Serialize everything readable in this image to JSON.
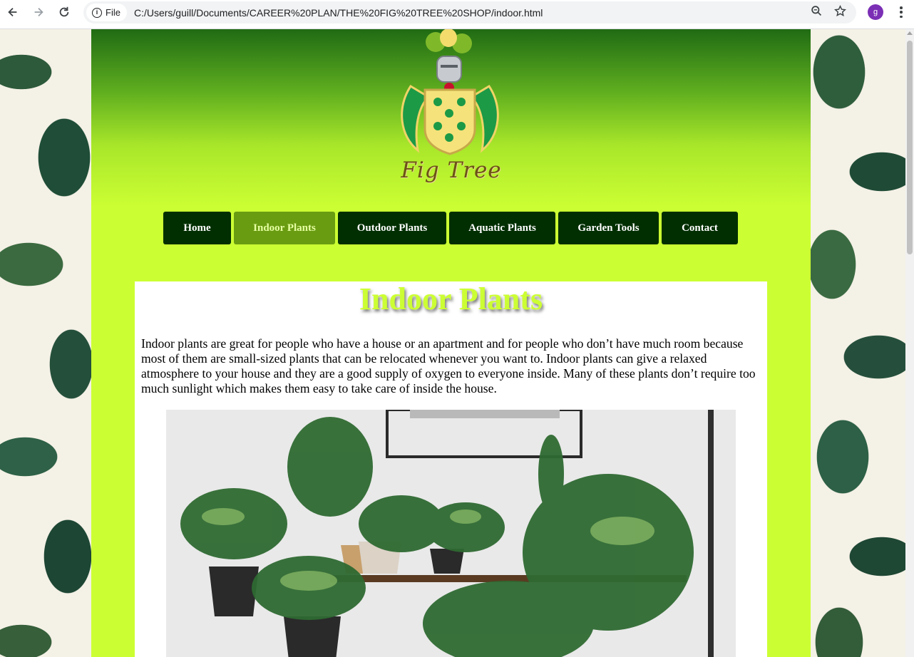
{
  "browser": {
    "site_chip_label": "File",
    "url": "C:/Users/guill/Documents/CAREER%20PLAN/THE%20FIG%20TREE%20SHOP/indoor.html",
    "profile_initial": "g"
  },
  "header": {
    "logo_text": "Fig Tree"
  },
  "nav": {
    "items": [
      {
        "label": "Home",
        "active": false
      },
      {
        "label": "Indoor Plants",
        "active": true
      },
      {
        "label": "Outdoor Plants",
        "active": false
      },
      {
        "label": "Aquatic Plants",
        "active": false
      },
      {
        "label": "Garden Tools",
        "active": false
      },
      {
        "label": "Contact",
        "active": false
      }
    ]
  },
  "main": {
    "title": "Indoor Plants",
    "intro": "Indoor plants are great for people who have a house or an apartment and for people who don’t have much room because most of them are small-sized plants that can be relocated whenever you want to. Indoor plants can give a relaxed atmosphere to your house and they are a good supply of oxygen to everyone inside. Many of these plants don’t require too much sunlight which makes them easy to take care of inside the house."
  },
  "colors": {
    "page_background": "#ccff33",
    "nav_background": "#012f02",
    "nav_active_background": "#6a9c12",
    "title_color": "#ccff33"
  }
}
